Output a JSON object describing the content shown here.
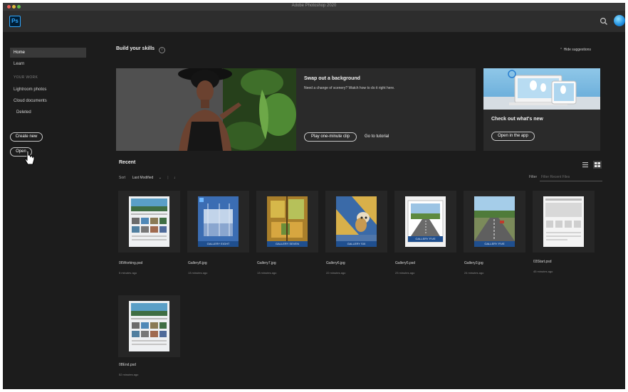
{
  "window": {
    "title": "Adobe Photoshop 2020"
  },
  "app": {
    "logo_text": "Ps"
  },
  "sidebar": {
    "home": "Home",
    "learn": "Learn",
    "your_work_heading": "YOUR WORK",
    "lightroom": "Lightroom photos",
    "cloud_docs": "Cloud documents",
    "deleted": "Deleted",
    "create_new": "Create new",
    "open": "Open"
  },
  "skills": {
    "title": "Build your skills",
    "hide_suggestions": "Hide suggestions",
    "hero": {
      "title": "Swap out a background",
      "description": "Need a change of scenery? Watch how to do it right here.",
      "play_button": "Play one-minute clip",
      "tutorial_link": "Go to tutorial"
    },
    "card": {
      "title": "Check out what's new",
      "button": "Open in the app"
    }
  },
  "recent": {
    "title": "Recent",
    "sort_label": "Sort",
    "sort_value": "Last Modified",
    "filter_label": "Filter",
    "filter_placeholder": "Filter Recent Files",
    "files": [
      {
        "name": "06Working.psd",
        "time": "5 minutes ago",
        "style": "layout"
      },
      {
        "name": "Gallery8.jpg",
        "time": "13 minutes ago",
        "style": "eight",
        "band": "GALLERY EIGHT"
      },
      {
        "name": "Gallery7.jpg",
        "time": "13 minutes ago",
        "style": "seven",
        "band": "GALLERY SEVEN"
      },
      {
        "name": "Gallery6.jpg",
        "time": "22 minutes ago",
        "style": "six",
        "band": "GALLERY SIX"
      },
      {
        "name": "Gallery5.psd",
        "time": "23 minutes ago",
        "style": "five",
        "band": "GALLERY FIVE"
      },
      {
        "name": "Gallery3.jpg",
        "time": "24 minutes ago",
        "style": "road",
        "band": "GALLERY FIVE"
      },
      {
        "name": "03Start.psd",
        "time": "45 minutes ago",
        "style": "wire"
      },
      {
        "name": "08End.psd",
        "time": "52 minutes ago",
        "style": "layout"
      }
    ]
  },
  "colors": {
    "accent": "#31a8ff",
    "background": "#1c1c1c",
    "panel": "#2d2d2d"
  }
}
